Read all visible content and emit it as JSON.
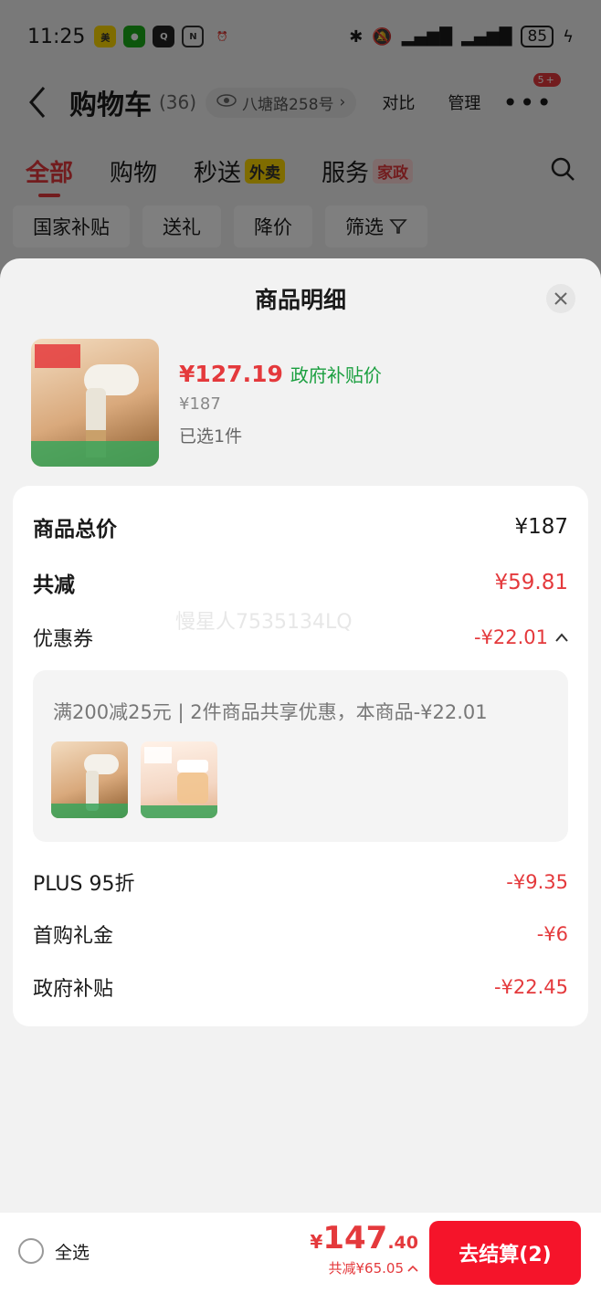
{
  "status_bar": {
    "time": "11:25",
    "battery": "85"
  },
  "header": {
    "title": "购物车",
    "count": "(36)",
    "address": "八塘路258号",
    "compare": "对比",
    "manage": "管理",
    "more_badge": "5+"
  },
  "tabs": [
    {
      "label": "全部"
    },
    {
      "label": "购物"
    },
    {
      "label": "秒送",
      "tag": "外卖"
    },
    {
      "label": "服务",
      "tag": "家政"
    }
  ],
  "filters": [
    "国家补贴",
    "送礼",
    "降价",
    "筛选"
  ],
  "sheet": {
    "title": "商品明细",
    "product": {
      "price": "¥127.19",
      "price_tag": "政府补贴价",
      "original_price": "¥187",
      "selected": "已选1件"
    },
    "summary": {
      "total_label": "商品总价",
      "total_value": "¥187",
      "discount_label": "共减",
      "discount_value": "¥59.81",
      "coupon_label": "优惠券",
      "coupon_value": "-¥22.01",
      "coupon_detail": "满200减25元 | 2件商品共享优惠，本商品-¥22.01",
      "plus_label": "PLUS 95折",
      "plus_value": "-¥9.35",
      "gift_label": "首购礼金",
      "gift_value": "-¥6",
      "gov_label": "政府补贴",
      "gov_value": "-¥22.45"
    },
    "watermark": "慢星人7535134LQ"
  },
  "bottom": {
    "select_all": "全选",
    "price_symbol": "¥",
    "price_int": "147",
    "price_dec": ".40",
    "total_discount": "共减¥65.05",
    "checkout": "去结算(2)"
  },
  "colors": {
    "accent": "#e4393c",
    "checkout": "#f5142a",
    "green": "#1a9f3f"
  }
}
